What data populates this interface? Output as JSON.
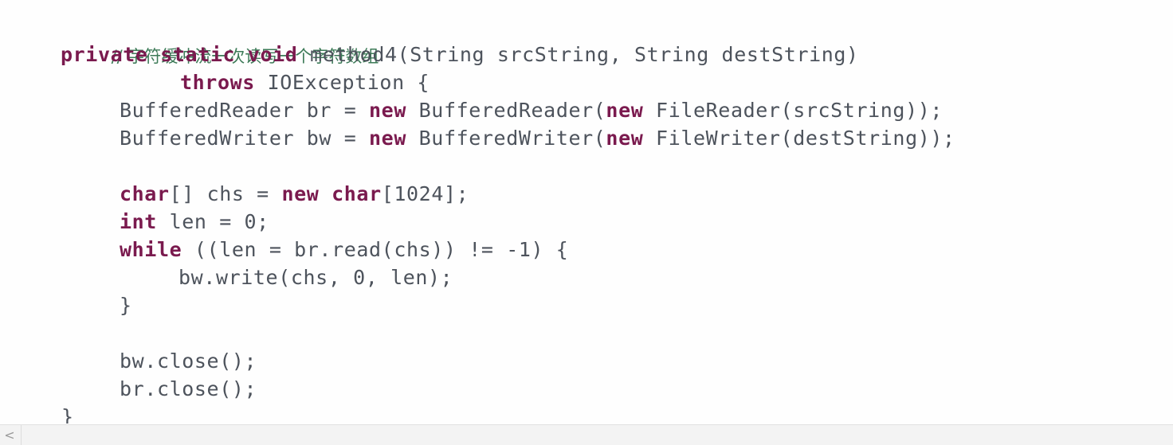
{
  "code": {
    "comment": "// 字符缓冲流一次读写一个字符数组",
    "l1_kw1": "private",
    "l1_kw2": "static",
    "l1_kw3": "void",
    "l1_rest": " method4(String srcString, String destString)",
    "l2_kw": "throws",
    "l2_rest": " IOException {",
    "l3_a": "BufferedReader br = ",
    "l3_kw1": "new",
    "l3_b": " BufferedReader(",
    "l3_kw2": "new",
    "l3_c": " FileReader(srcString));",
    "l4_a": "BufferedWriter bw = ",
    "l4_kw1": "new",
    "l4_b": " BufferedWriter(",
    "l4_kw2": "new",
    "l4_c": " FileWriter(destString));",
    "l6_kw1": "char",
    "l6_a": "[] chs = ",
    "l6_kw2": "new",
    "l6_kw3": "char",
    "l6_b": "[1024];",
    "l7_kw": "int",
    "l7_a": " len = 0;",
    "l8_kw": "while",
    "l8_a": " ((len = br.read(chs)) != -1) {",
    "l9": "bw.write(chs, 0, len);",
    "l10": "}",
    "l12": "bw.close();",
    "l13": "br.close();",
    "l14": "}"
  },
  "scrollbar": {
    "left_arrow": "<"
  }
}
